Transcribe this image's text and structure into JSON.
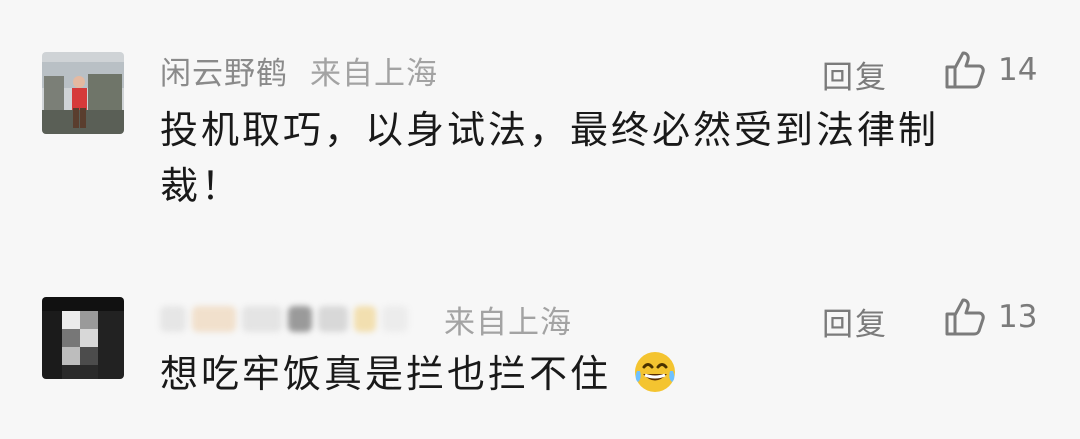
{
  "comments": [
    {
      "user": "闲云野鹤",
      "region": "来自上海",
      "reply_label": "回复",
      "likes": "14",
      "text": "投机取巧，以身试法，最终必然受到法律制裁！",
      "avatar_icon": "user-photo-avatar"
    },
    {
      "user": "",
      "region": "来自上海",
      "reply_label": "回复",
      "likes": "13",
      "text": "想吃牢饭真是拦也拦不住",
      "emoji": "tears-of-joy-emoji",
      "avatar_icon": "pixelated-avatar"
    }
  ],
  "colors": {
    "background": "#f7f7f7",
    "text": "#191919",
    "meta": "#8a8a8a",
    "emoji": "#f4c430"
  }
}
